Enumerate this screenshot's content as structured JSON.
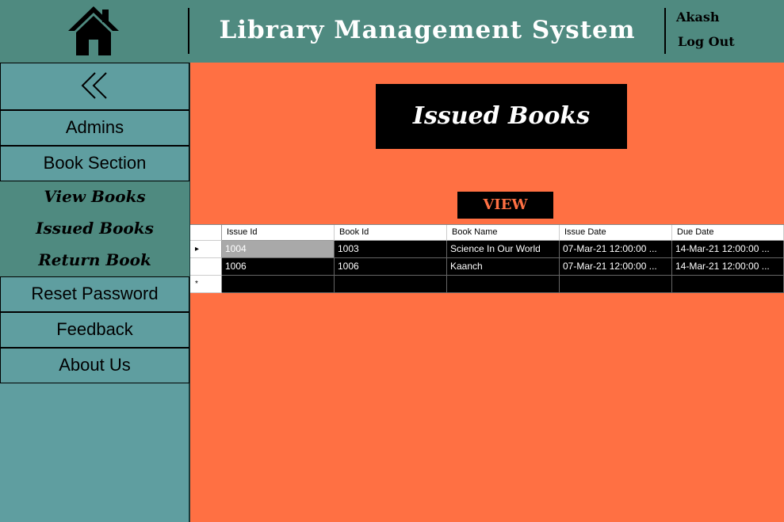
{
  "header": {
    "title": "Library Management System",
    "user": "Akash",
    "logout_label": "Log Out"
  },
  "sidebar": {
    "collapse_icon": "double-chevron-left-icon",
    "items": [
      {
        "label": "Admins"
      },
      {
        "label": "Book Section"
      },
      {
        "label": "Reset Password"
      },
      {
        "label": "Feedback"
      },
      {
        "label": "About Us"
      }
    ],
    "submenu": [
      {
        "label": "View Books"
      },
      {
        "label": "Issued Books"
      },
      {
        "label": "Return Book"
      }
    ]
  },
  "main": {
    "title": "Issued Books",
    "view_label": "VIEW"
  },
  "grid": {
    "columns": [
      "Issue Id",
      "Book Id",
      "Book Name",
      "Issue Date",
      "Due Date"
    ],
    "rows": [
      [
        "1004",
        "1003",
        "Science In Our World",
        "07-Mar-21 12:00:00 ...",
        "14-Mar-21 12:00:00 ..."
      ],
      [
        "1006",
        "1006",
        "Kaanch",
        "07-Mar-21 12:00:00 ...",
        "14-Mar-21 12:00:00 ..."
      ]
    ],
    "current_row_marker": "▸",
    "new_row_marker": "*"
  },
  "colors": {
    "header_bg": "#4f8a80",
    "sidebar_bg": "#5f9ea0",
    "main_bg": "#ff7043",
    "accent": "#000000"
  }
}
